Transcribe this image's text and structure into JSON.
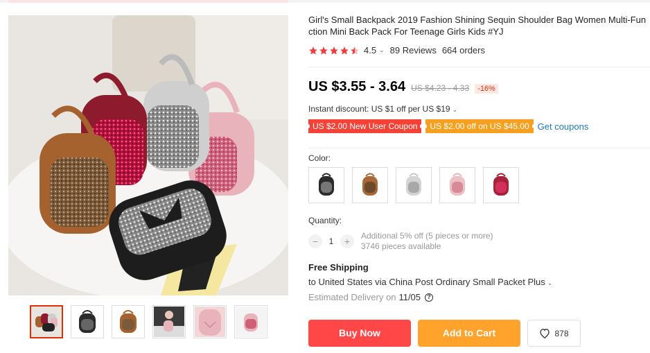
{
  "product": {
    "title": "Girl's Small Backpack 2019 Fashion Shining Sequin Shoulder Bag Women Multi-Function Mini Back Pack For Teenage Girls Kids #YJ",
    "rating": "4.5",
    "rating_value": 4.5,
    "reviews": "89 Reviews",
    "orders": "664 orders"
  },
  "price": {
    "current": "US $3.55 - 3.64",
    "original": "US $4.23 - 4.33",
    "discount": "-16%"
  },
  "promotions": {
    "instant_discount": "Instant discount: US $1 off per US $19",
    "coupons": [
      "US $2.00 New User Coupon",
      "US $2.00 off on US $45.00"
    ],
    "get_coupons": "Get coupons"
  },
  "options": {
    "color_label": "Color:",
    "colors": [
      {
        "name": "black",
        "hex": "#2b2b2b"
      },
      {
        "name": "brown",
        "hex": "#a9683a"
      },
      {
        "name": "silver",
        "hex": "#c9c9c9"
      },
      {
        "name": "pink",
        "hex": "#e8b4bb"
      },
      {
        "name": "red",
        "hex": "#a8213a"
      }
    ],
    "quantity_label": "Quantity:",
    "quantity": "1",
    "decrement": "−",
    "increment": "+",
    "additional_discount": "Additional 5% off (5 pieces or more)",
    "available": "3746 pieces available"
  },
  "shipping": {
    "title": "Free Shipping",
    "via": "to United States via China Post Ordinary Small Packet Plus",
    "delivery_label": "Estimated Delivery on",
    "delivery_date": "11/05"
  },
  "actions": {
    "buy_now": "Buy Now",
    "add_to_cart": "Add to Cart",
    "wishlist_count": "878"
  },
  "gallery": {
    "thumbnail_count": 6
  },
  "colors": {
    "accent_red": "#ff4747",
    "accent_orange": "#ffa32c",
    "star": "#f23c3c",
    "link": "#1a7cb8"
  }
}
